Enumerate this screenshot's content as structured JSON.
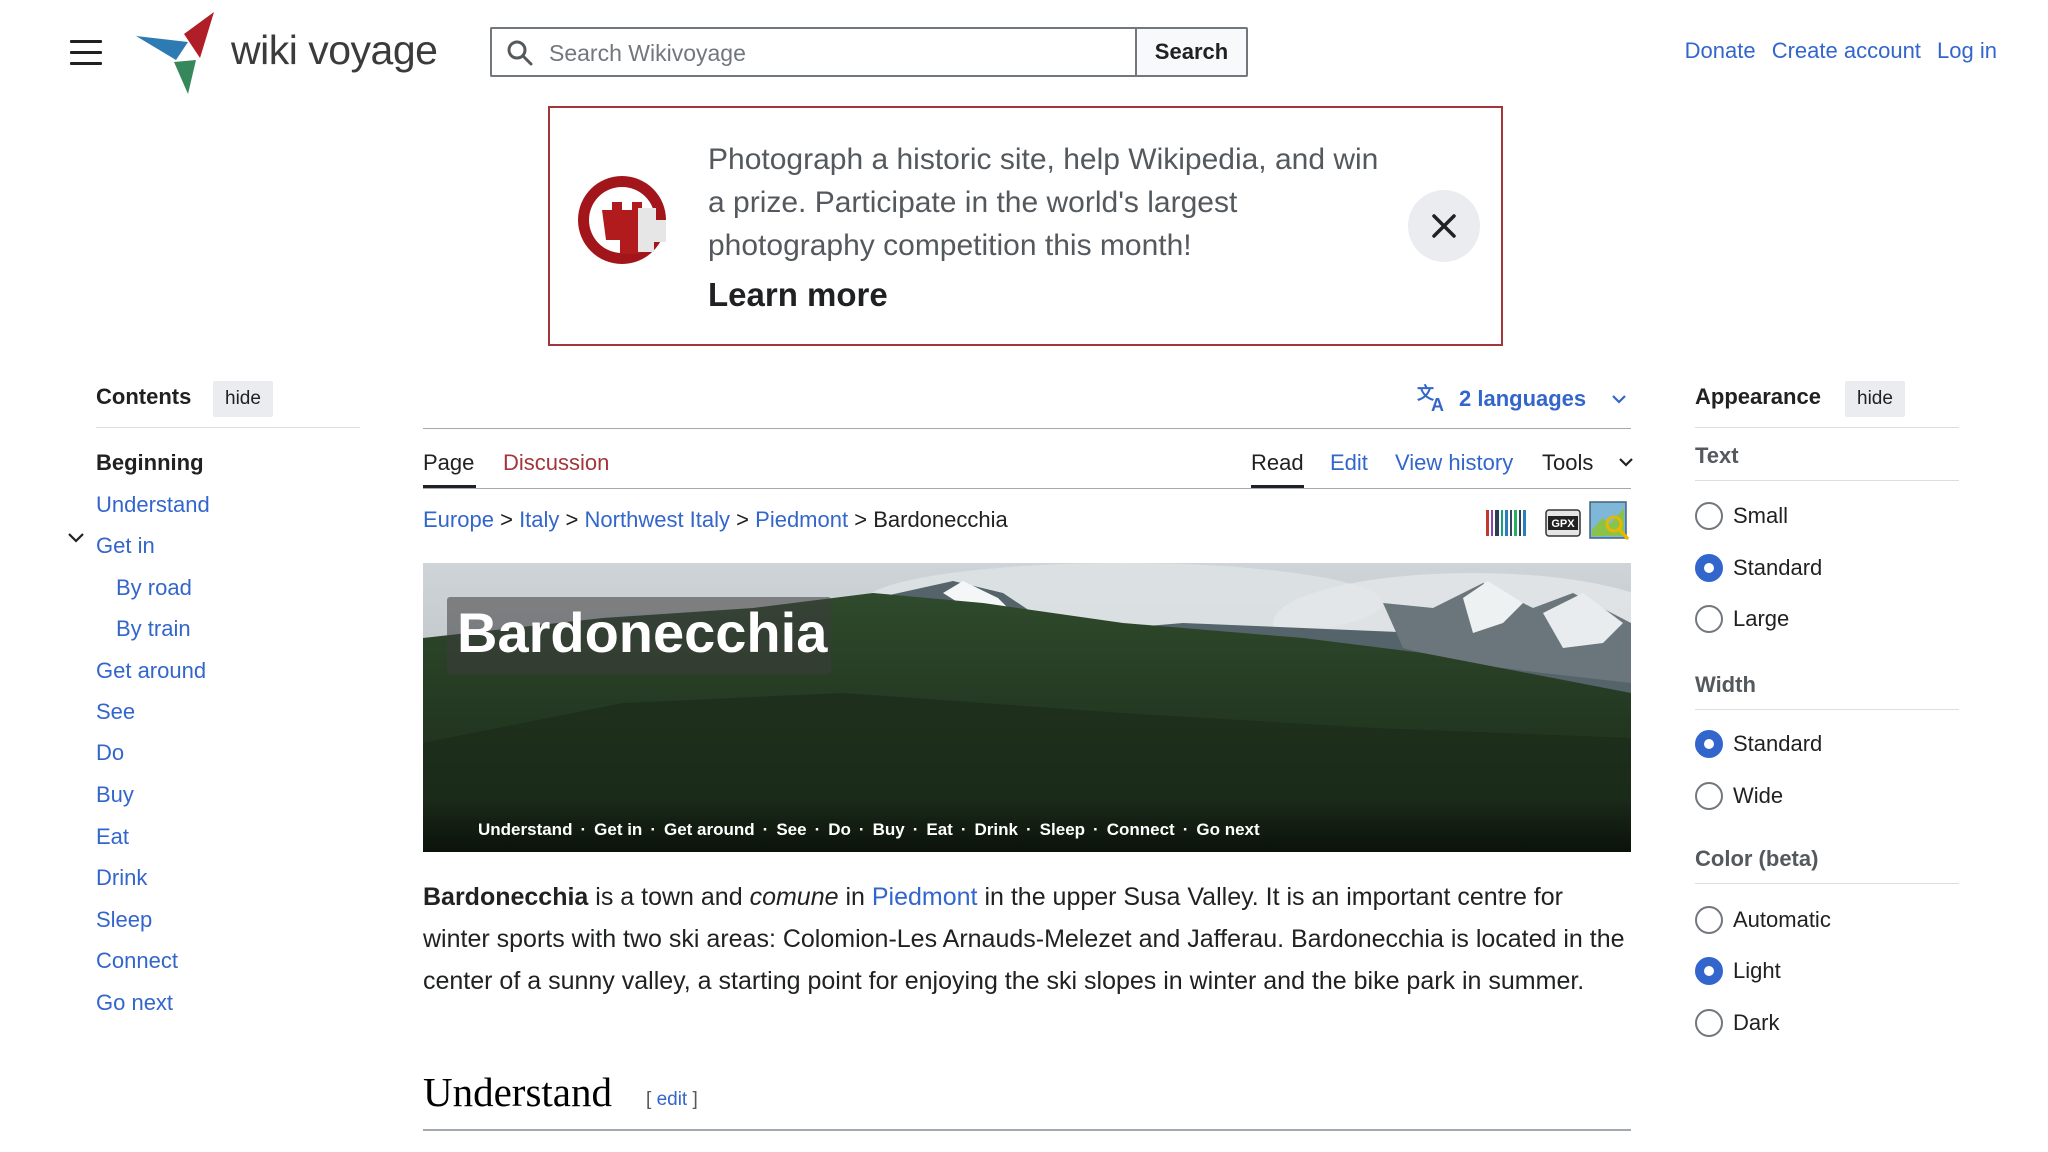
{
  "header": {
    "logo_text": "wiki voyage",
    "search_placeholder": "Search Wikivoyage",
    "search_button": "Search",
    "links": [
      "Donate",
      "Create account",
      "Log in"
    ]
  },
  "banner": {
    "text": "Photograph a historic site, help Wikipedia, and win a prize. Participate in the world's largest photography competition this month!",
    "learn_more": "Learn more"
  },
  "toc": {
    "title": "Contents",
    "hide": "hide",
    "items": [
      {
        "label": "Beginning"
      },
      {
        "label": "Understand"
      },
      {
        "label": "Get in"
      },
      {
        "label": "By road"
      },
      {
        "label": "By train"
      },
      {
        "label": "Get around"
      },
      {
        "label": "See"
      },
      {
        "label": "Do"
      },
      {
        "label": "Buy"
      },
      {
        "label": "Eat"
      },
      {
        "label": "Drink"
      },
      {
        "label": "Sleep"
      },
      {
        "label": "Connect"
      },
      {
        "label": "Go next"
      }
    ]
  },
  "languages": "2 languages",
  "tabs": {
    "page": "Page",
    "discussion": "Discussion",
    "read": "Read",
    "edit": "Edit",
    "history": "View history",
    "tools": "Tools"
  },
  "breadcrumb": {
    "items": [
      "Europe",
      "Italy",
      "Northwest Italy",
      "Piedmont"
    ],
    "current": "Bardonecchia",
    "separator": ">"
  },
  "hero": {
    "title": "Bardonecchia",
    "nav": [
      "Understand",
      "Get in",
      "Get around",
      "See",
      "Do",
      "Buy",
      "Eat",
      "Drink",
      "Sleep",
      "Connect",
      "Go next"
    ]
  },
  "article": {
    "bold": "Bardonecchia",
    "t1": " is a town and ",
    "italic": "comune",
    "t2": " in ",
    "link": "Piedmont",
    "t3": " in the upper Susa Valley. It is an important centre for winter sports with two ski areas: Colomion-Les Arnauds-Melezet and Jafferau. Bardonecchia is located in the center of a sunny valley, a starting point for enjoying the ski slopes in winter and the bike park in summer.",
    "section_title": "Understand",
    "edit_open": "[ ",
    "edit_label": "edit",
    "edit_close": " ]"
  },
  "appearance": {
    "title": "Appearance",
    "hide": "hide",
    "text_label": "Text",
    "text_options": [
      "Small",
      "Standard",
      "Large"
    ],
    "text_selected": "Standard",
    "width_label": "Width",
    "width_options": [
      "Standard",
      "Wide"
    ],
    "width_selected": "Standard",
    "color_label": "Color (beta)",
    "color_options": [
      "Automatic",
      "Light",
      "Dark"
    ],
    "color_selected": "Light"
  },
  "colors": {
    "link": "#3366cc",
    "discussion_link": "#a2363a",
    "banner_border": "#a2363a",
    "text": "#202122"
  },
  "icons": [
    "menu-icon",
    "search-icon",
    "close-icon",
    "translate-icon",
    "chevron-down-icon",
    "barcode-icon",
    "gpx-icon",
    "map-icon"
  ]
}
